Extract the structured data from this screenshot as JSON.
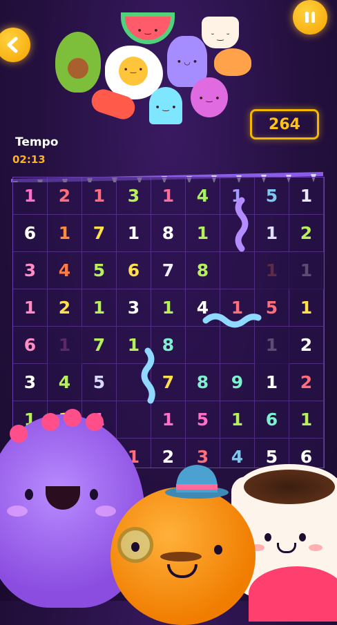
{
  "header": {
    "back_icon": "chevron-left-icon",
    "pause_icon": "pause-icon"
  },
  "score": {
    "value": "264"
  },
  "timer": {
    "label": "Tempo",
    "value": "02:13"
  },
  "colors": {
    "1": "#ff6ec7",
    "2": "#ff8c3a",
    "3": "#b6f05a",
    "4": "#d8d8ff",
    "5": "#7ef0d0",
    "6": "#ffffff",
    "7": "#ffe14a",
    "8": "#c6b6ff",
    "9": "#9af3ff",
    "accent": "#f5b800"
  },
  "grid": {
    "rows": [
      [
        {
          "v": "1",
          "c": "#ff6ec7"
        },
        {
          "v": "2",
          "c": "#ff6e7a"
        },
        {
          "v": "1",
          "c": "#ff6e7a"
        },
        {
          "v": "3",
          "c": "#b6f05a"
        },
        {
          "v": "1",
          "c": "#ff6e9a"
        },
        {
          "v": "4",
          "c": "#a8f060"
        },
        {
          "v": "1",
          "c": "#a39bff"
        },
        {
          "v": "5",
          "c": "#7ec8f0"
        },
        {
          "v": "1",
          "c": "#eaeaff"
        }
      ],
      [
        {
          "v": "6",
          "c": "#ffffff"
        },
        {
          "v": "1",
          "c": "#ff8c3a"
        },
        {
          "v": "7",
          "c": "#ffe14a"
        },
        {
          "v": "1",
          "c": "#ffffff"
        },
        {
          "v": "8",
          "c": "#ffffff"
        },
        {
          "v": "1",
          "c": "#b6f05a"
        },
        {
          "v": "",
          "c": ""
        },
        {
          "v": "1",
          "c": "#e0e0ff"
        },
        {
          "v": "2",
          "c": "#b6f05a"
        }
      ],
      [
        {
          "v": "3",
          "c": "#ff8cc2"
        },
        {
          "v": "4",
          "c": "#ff7a3d"
        },
        {
          "v": "5",
          "c": "#b6f05a"
        },
        {
          "v": "6",
          "c": "#ffe14a"
        },
        {
          "v": "7",
          "c": "#eeeeff"
        },
        {
          "v": "8",
          "c": "#b6f05a"
        },
        {
          "v": "",
          "c": ""
        },
        {
          "v": "1",
          "c": "#ff7a3d",
          "dim": true
        },
        {
          "v": "1",
          "c": "#ffffff",
          "dim": true
        }
      ],
      [
        {
          "v": "1",
          "c": "#ff8cc2"
        },
        {
          "v": "2",
          "c": "#ffe14a"
        },
        {
          "v": "1",
          "c": "#b6f05a"
        },
        {
          "v": "3",
          "c": "#ffffff"
        },
        {
          "v": "1",
          "c": "#b6f05a"
        },
        {
          "v": "4",
          "c": "#ffffff"
        },
        {
          "v": "1",
          "c": "#ff6e7a"
        },
        {
          "v": "5",
          "c": "#ff6e7a"
        },
        {
          "v": "1",
          "c": "#ffe14a"
        }
      ],
      [
        {
          "v": "6",
          "c": "#ff8cc2"
        },
        {
          "v": "1",
          "c": "#ff6ec7",
          "dim": true
        },
        {
          "v": "7",
          "c": "#b6f05a"
        },
        {
          "v": "1",
          "c": "#b6f05a"
        },
        {
          "v": "8",
          "c": "#7ef0d0"
        },
        {
          "v": "",
          "c": ""
        },
        {
          "v": "",
          "c": ""
        },
        {
          "v": "1",
          "c": "#ffffff",
          "dim": true
        },
        {
          "v": "2",
          "c": "#ffffff"
        }
      ],
      [
        {
          "v": "3",
          "c": "#ffffff"
        },
        {
          "v": "4",
          "c": "#b6f05a"
        },
        {
          "v": "5",
          "c": "#d8d8ff"
        },
        {
          "v": "",
          "c": ""
        },
        {
          "v": "7",
          "c": "#ffe14a"
        },
        {
          "v": "8",
          "c": "#7ef0d0"
        },
        {
          "v": "9",
          "c": "#7ef0d0"
        },
        {
          "v": "1",
          "c": "#ffffff"
        },
        {
          "v": "2",
          "c": "#ff6e7a"
        }
      ],
      [
        {
          "v": "1",
          "c": "#b6f05a"
        },
        {
          "v": "3",
          "c": "#ffe14a"
        },
        {
          "v": "1",
          "c": "#ff6ec7"
        },
        {
          "v": "",
          "c": ""
        },
        {
          "v": "1",
          "c": "#ff6ec7"
        },
        {
          "v": "5",
          "c": "#ff6ec7"
        },
        {
          "v": "1",
          "c": "#b6f05a"
        },
        {
          "v": "6",
          "c": "#7ef0d0"
        },
        {
          "v": "1",
          "c": "#b6f05a"
        }
      ],
      [
        {
          "v": "",
          "c": ""
        },
        {
          "v": "",
          "c": ""
        },
        {
          "v": "8",
          "c": "#ff6ec7"
        },
        {
          "v": "1",
          "c": "#ff6e7a"
        },
        {
          "v": "2",
          "c": "#ffffff"
        },
        {
          "v": "3",
          "c": "#ff6e7a"
        },
        {
          "v": "4",
          "c": "#7ec8f0"
        },
        {
          "v": "5",
          "c": "#ffffff"
        },
        {
          "v": "6",
          "c": "#ffffff"
        }
      ]
    ]
  },
  "characters": {
    "top_cluster": [
      "avocado-icon",
      "watermelon-icon",
      "coffee-cup-icon",
      "egg-icon",
      "dinosaur-icon",
      "croissant-icon",
      "sausage-icon",
      "ghost-icon",
      "eggplant-icon"
    ],
    "bottom": [
      "purple-monster-icon",
      "orange-monster-icon",
      "coffee-cup-icon"
    ]
  }
}
